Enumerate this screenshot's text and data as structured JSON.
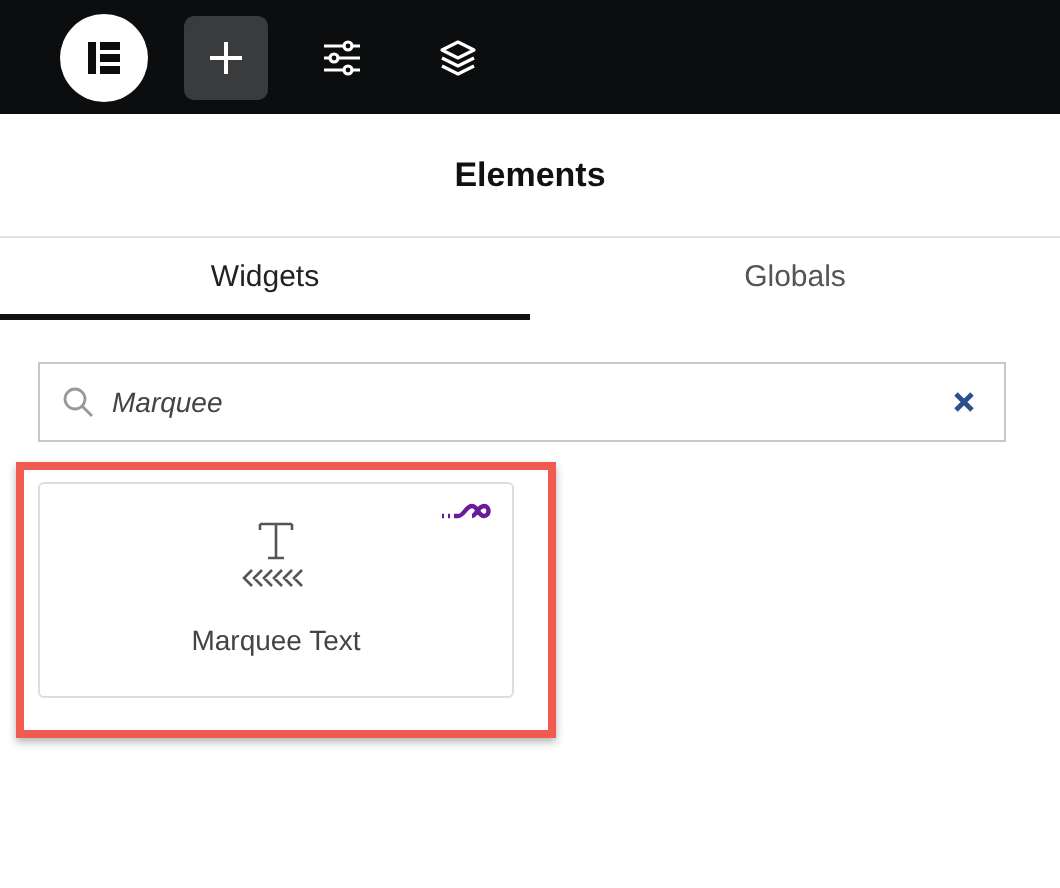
{
  "toolbar": {
    "buttons": [
      {
        "kind": "logo"
      },
      {
        "kind": "add",
        "selected": true
      },
      {
        "kind": "settings",
        "selected": false
      },
      {
        "kind": "layers",
        "selected": false
      }
    ]
  },
  "panel": {
    "title": "Elements"
  },
  "tabs": [
    {
      "label": "Widgets",
      "selected": true
    },
    {
      "label": "Globals",
      "selected": false
    }
  ],
  "search": {
    "value": "Marquee"
  },
  "widgets": [
    {
      "name": "Marquee Text",
      "highlighted": true
    }
  ]
}
